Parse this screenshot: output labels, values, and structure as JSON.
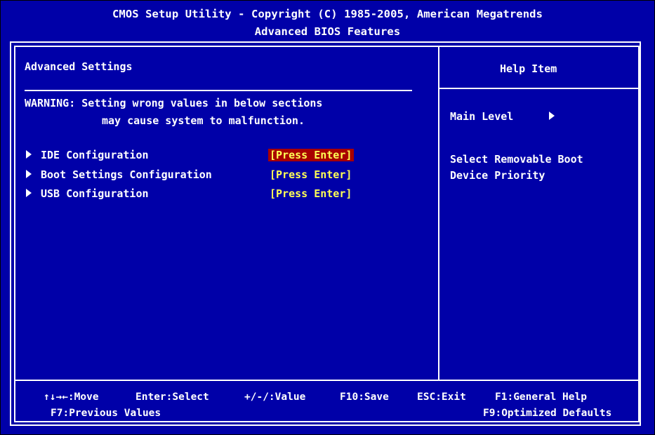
{
  "header": {
    "title": "CMOS Setup Utility - Copyright (C) 1985-2005, American Megatrends",
    "subtitle": "Advanced BIOS Features"
  },
  "main": {
    "section_title": "Advanced Settings",
    "warning_line1": "WARNING: Setting wrong values in below sections",
    "warning_line2": "may cause system to malfunction.",
    "items": [
      {
        "label": "IDE Configuration",
        "value": "[Press Enter]",
        "selected": true
      },
      {
        "label": "Boot Settings Configuration",
        "value": "[Press Enter]",
        "selected": false
      },
      {
        "label": "USB Configuration",
        "value": "[Press Enter]",
        "selected": false
      }
    ]
  },
  "help": {
    "title": "Help Item",
    "level": "Main Level",
    "description_line1": "Select Removable Boot",
    "description_line2": "Device Priority"
  },
  "footer": {
    "move": "↑↓→←:Move",
    "select": "Enter:Select",
    "value": "+/-/:Value",
    "save": "F10:Save",
    "exit": "ESC:Exit",
    "general_help": "F1:General Help",
    "previous": "F7:Previous Values",
    "defaults": "F9:Optimized Defaults"
  },
  "colors": {
    "background": "#0000a8",
    "text": "#ffffff",
    "value_text": "#ffff55",
    "selection": "#a80000"
  }
}
